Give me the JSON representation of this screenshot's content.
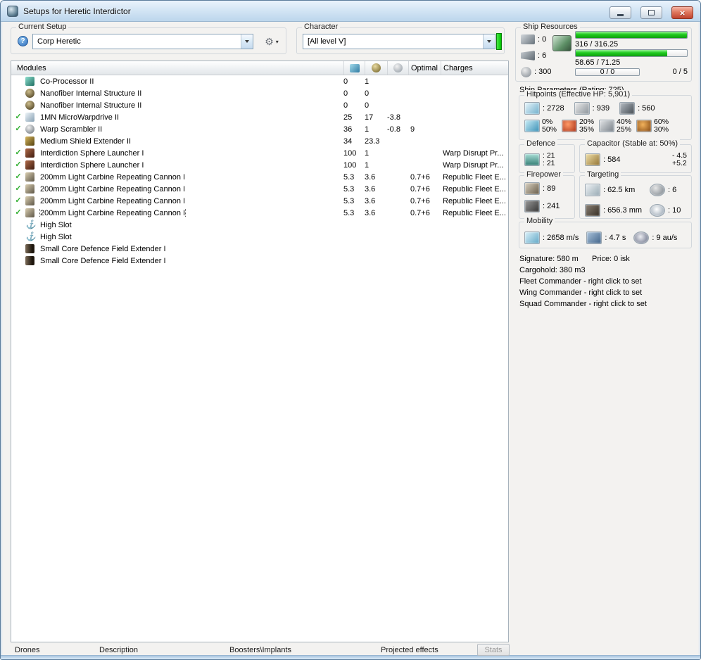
{
  "window": {
    "title": "Setups for Heretic Interdictor"
  },
  "colors": {
    "progress_green": "#1ecb1e",
    "skill_indicator_green": "#00c400",
    "active_check_green": "#2fae2f",
    "close_button_red": "#c04430"
  },
  "current_setup": {
    "label": "Current Setup",
    "value": "Corp Heretic"
  },
  "character": {
    "label": "Character",
    "value": "[All level V]"
  },
  "ship_resources": {
    "label": "Ship Resources",
    "slots": [
      {
        "icon": "turret-hardpoints-icon",
        "text": ": 0"
      },
      {
        "icon": "launcher-hardpoints-icon",
        "text": ": 6"
      },
      {
        "icon": "calibration-icon",
        "text": ": 300"
      }
    ],
    "cpu_icon": "cpu-chip-icon",
    "bars": [
      {
        "text": "316 / 316.25",
        "pct": 100
      },
      {
        "text": "58.65 / 71.25",
        "pct": 82
      },
      {
        "text": "0 / 0",
        "pct": 0
      }
    ],
    "drones_text": "0 / 5"
  },
  "modules": {
    "header": {
      "name": "Modules",
      "optimal": "Optimal",
      "charges": "Charges",
      "icons": [
        "cpu-icon",
        "powergrid-icon",
        "capacitor-icon"
      ]
    },
    "rows": [
      {
        "check": false,
        "icon": "coprocessor-icon",
        "name": "Co-Processor II",
        "cpu": "0",
        "pg": "1",
        "cap": "",
        "optimal": "",
        "charges": ""
      },
      {
        "check": false,
        "icon": "nanofiber-icon",
        "name": "Nanofiber Internal Structure II",
        "cpu": "0",
        "pg": "0",
        "cap": "",
        "optimal": "",
        "charges": ""
      },
      {
        "check": false,
        "icon": "nanofiber-icon",
        "name": "Nanofiber Internal Structure II",
        "cpu": "0",
        "pg": "0",
        "cap": "",
        "optimal": "",
        "charges": ""
      },
      {
        "check": true,
        "icon": "mwd-icon",
        "name": "1MN MicroWarpdrive II",
        "cpu": "25",
        "pg": "17",
        "cap": "-3.8",
        "optimal": "",
        "charges": ""
      },
      {
        "check": true,
        "icon": "warp-scrambler-icon",
        "name": "Warp Scrambler II",
        "cpu": "36",
        "pg": "1",
        "cap": "-0.8",
        "optimal": "9",
        "charges": ""
      },
      {
        "check": false,
        "icon": "shield-extender-icon",
        "name": "Medium Shield Extender II",
        "cpu": "34",
        "pg": "23.3",
        "cap": "",
        "optimal": "",
        "charges": ""
      },
      {
        "check": true,
        "icon": "interdiction-launcher-icon",
        "name": "Interdiction Sphere Launcher I",
        "cpu": "100",
        "pg": "1",
        "cap": "",
        "optimal": "",
        "charges": "Warp Disrupt Pr..."
      },
      {
        "check": true,
        "icon": "interdiction-launcher-icon",
        "name": "Interdiction Sphere Launcher I",
        "cpu": "100",
        "pg": "1",
        "cap": "",
        "optimal": "",
        "charges": "Warp Disrupt Pr..."
      },
      {
        "check": true,
        "icon": "autocannon-icon",
        "name": "200mm Light Carbine Repeating Cannon I",
        "cpu": "5.3",
        "pg": "3.6",
        "cap": "",
        "optimal": "0.7+6",
        "charges": "Republic Fleet E..."
      },
      {
        "check": true,
        "icon": "autocannon-icon",
        "name": "200mm Light Carbine Repeating Cannon I",
        "cpu": "5.3",
        "pg": "3.6",
        "cap": "",
        "optimal": "0.7+6",
        "charges": "Republic Fleet E..."
      },
      {
        "check": true,
        "icon": "autocannon-icon",
        "name": "200mm Light Carbine Repeating Cannon I",
        "cpu": "5.3",
        "pg": "3.6",
        "cap": "",
        "optimal": "0.7+6",
        "charges": "Republic Fleet E..."
      },
      {
        "check": true,
        "icon": "autocannon-icon",
        "name": "200mm Light Carbine Repeating Cannon I",
        "cpu": "5.3",
        "pg": "3.6",
        "cap": "",
        "optimal": "0.7+6",
        "charges": "Republic Fleet E...",
        "selected": true
      },
      {
        "check": false,
        "icon": "empty-highslot-icon",
        "name": "High Slot",
        "cpu": "",
        "pg": "",
        "cap": "",
        "optimal": "",
        "charges": ""
      },
      {
        "check": false,
        "icon": "empty-highslot-icon",
        "name": "High Slot",
        "cpu": "",
        "pg": "",
        "cap": "",
        "optimal": "",
        "charges": ""
      },
      {
        "check": false,
        "icon": "rig-icon",
        "name": "Small Core Defence Field Extender I",
        "cpu": "",
        "pg": "",
        "cap": "",
        "optimal": "",
        "charges": ""
      },
      {
        "check": false,
        "icon": "rig-icon",
        "name": "Small Core Defence Field Extender I",
        "cpu": "",
        "pg": "",
        "cap": "",
        "optimal": "",
        "charges": ""
      }
    ]
  },
  "tabs": [
    {
      "label": "Drones"
    },
    {
      "label": "Description"
    },
    {
      "label": "Boosters\\Implants"
    },
    {
      "label": "Projected effects"
    }
  ],
  "stats_button": {
    "label": "Stats"
  },
  "ship_parameters": {
    "title": "Ship Parameters (Rating: 725)",
    "hitpoints": {
      "label": "Hitpoints (Effective HP: 5,901)",
      "values": [
        {
          "icon": "shield-hp-icon",
          "text": ": 2728"
        },
        {
          "icon": "armor-hp-icon",
          "text": ": 939"
        },
        {
          "icon": "hull-hp-icon",
          "text": ": 560"
        }
      ],
      "resists": [
        {
          "icon": "em-resist-icon",
          "shield": "0%",
          "armor": "50%"
        },
        {
          "icon": "thermal-resist-icon",
          "shield": "20%",
          "armor": "35%"
        },
        {
          "icon": "kinetic-resist-icon",
          "shield": "40%",
          "armor": "25%"
        },
        {
          "icon": "explosive-resist-icon",
          "shield": "60%",
          "armor": "30%"
        }
      ]
    },
    "defence": {
      "label": "Defence",
      "icon": "defence-icon",
      "top": ": 21",
      "bottom": ": 21"
    },
    "capacitor": {
      "label": "Capacitor (Stable at: 50%)",
      "icon": "capacitor-icon",
      "text": ": 584",
      "out": "- 4.5",
      "in": "+5.2"
    },
    "firepower": {
      "label": "Firepower",
      "rows": [
        {
          "icon": "volley-icon",
          "text": ": 89"
        },
        {
          "icon": "dps-icon",
          "text": ": 241"
        }
      ]
    },
    "targeting": {
      "label": "Targeting",
      "cells": [
        {
          "icon": "targeting-range-icon",
          "text": ": 62.5 km"
        },
        {
          "icon": "max-targets-icon",
          "text": ": 6"
        },
        {
          "icon": "scan-resolution-icon",
          "text": ": 656.3 mm"
        },
        {
          "icon": "sensor-strength-icon",
          "text": ": 10"
        }
      ]
    },
    "mobility": {
      "label": "Mobility",
      "cells": [
        {
          "icon": "max-velocity-icon",
          "text": ": 2658 m/s"
        },
        {
          "icon": "agility-icon",
          "text": ": 4.7 s"
        },
        {
          "icon": "warp-speed-icon",
          "text": ": 9 au/s"
        }
      ]
    },
    "info": {
      "signature": "Signature: 580 m",
      "price": "Price: 0 isk",
      "cargohold": "Cargohold: 380 m3",
      "fleet": "Fleet Commander - right click to set",
      "wing": "Wing Commander - right click to set",
      "squad": "Squad Commander - right click to set"
    }
  }
}
